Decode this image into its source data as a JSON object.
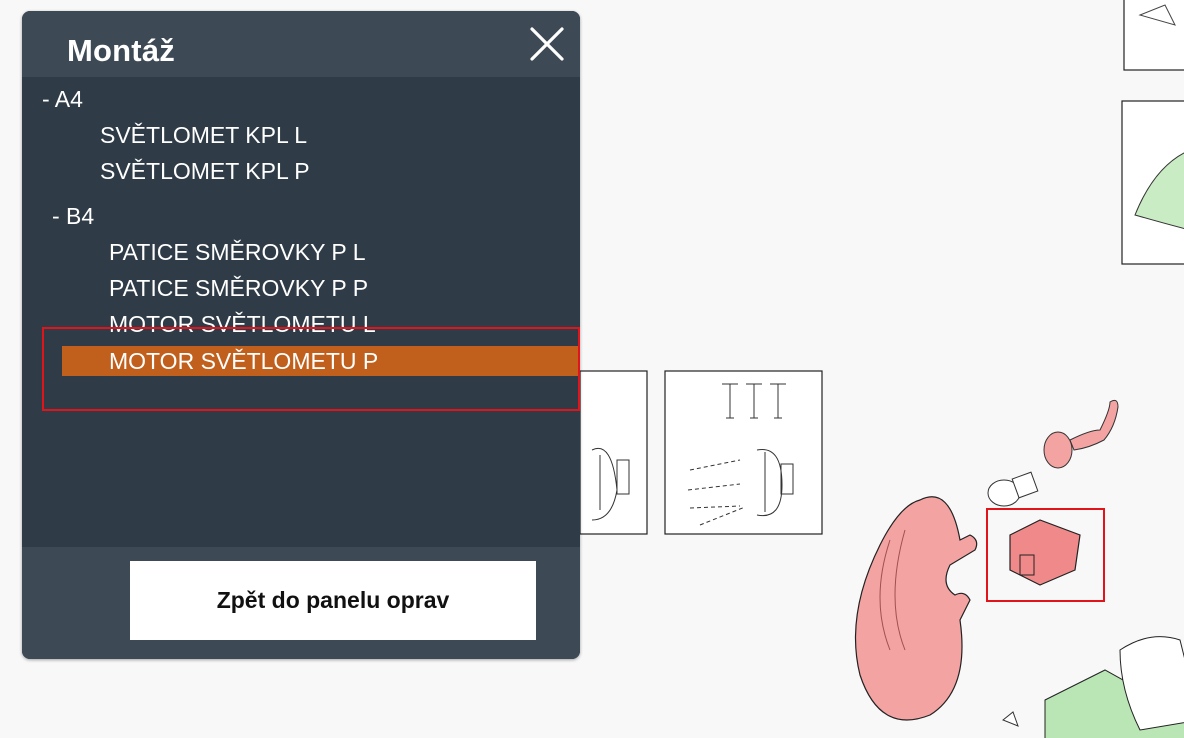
{
  "panel": {
    "title": "Montáž",
    "close_icon": "close-icon",
    "tree": [
      {
        "label": "-  A4",
        "kind": "group"
      },
      {
        "label": "SVĚTLOMET KPL L",
        "kind": "item"
      },
      {
        "label": "SVĚTLOMET KPL P",
        "kind": "item"
      },
      {
        "label": "-  B4",
        "kind": "group"
      },
      {
        "label": "PATICE SMĚROVKY P L",
        "kind": "item"
      },
      {
        "label": "PATICE SMĚROVKY P P",
        "kind": "item"
      },
      {
        "label": "MOTOR SVĚTLOMETU L",
        "kind": "item"
      },
      {
        "label": "MOTOR SVĚTLOMETU P",
        "kind": "item",
        "selected": true
      }
    ],
    "back_button": "Zpět do panelu oprav"
  },
  "colors": {
    "panel_bg": "#2f3c47",
    "panel_header": "#3d4a56",
    "selected_row": "#c0601c",
    "highlight": "#e2141b",
    "part_pink": "#f4a3a3",
    "part_green": "#b9e6b4"
  }
}
